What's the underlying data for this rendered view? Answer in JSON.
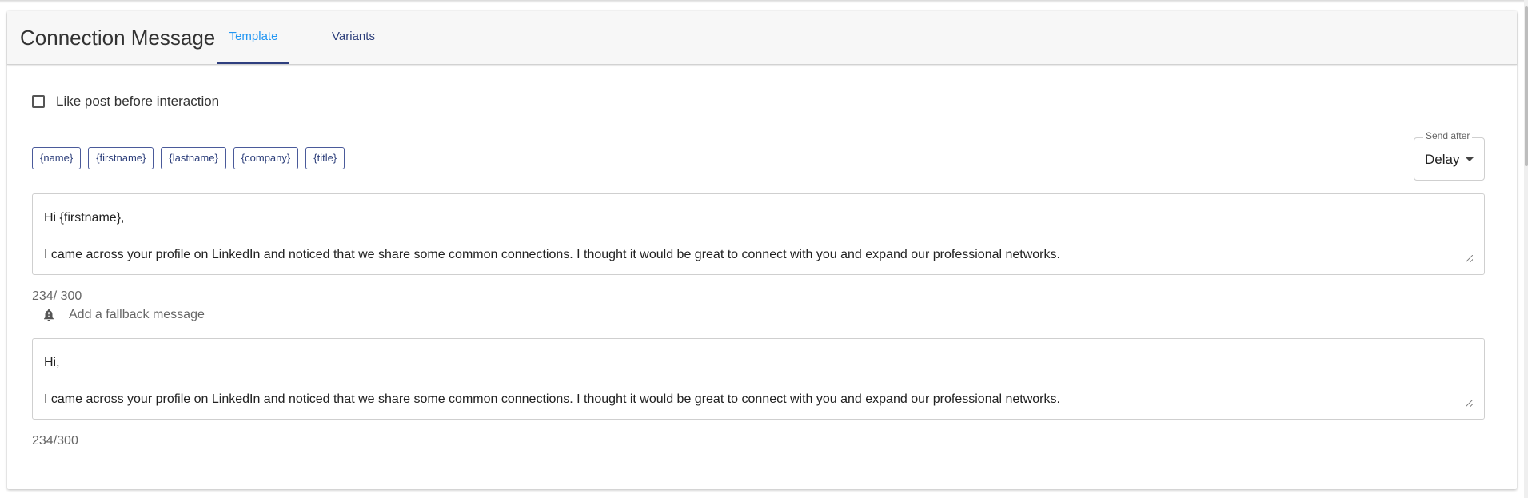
{
  "header": {
    "title": "Connection Message",
    "tabs": [
      {
        "label": "Template",
        "active": true
      },
      {
        "label": "Variants",
        "active": false
      }
    ]
  },
  "options": {
    "like_post_label": "Like post before interaction",
    "like_post_checked": false
  },
  "variables": [
    "{name}",
    "{firstname}",
    "{lastname}",
    "{company}",
    "{title}"
  ],
  "send_after": {
    "label": "Send after",
    "value": "Delay"
  },
  "message": {
    "lines": [
      "Hi {firstname},",
      "I came across your profile on LinkedIn and noticed that we share some common connections. I thought it would be great to connect with you and expand our professional networks."
    ],
    "counter": "234/ 300"
  },
  "fallback": {
    "toggle_label": "Add a fallback message",
    "icon": "bell-alert-icon",
    "lines": [
      "Hi,",
      "I came across your profile on LinkedIn and noticed that we share some common connections. I thought it would be great to connect with you and expand our professional networks."
    ],
    "counter": "234/300"
  },
  "colors": {
    "accent_blue": "#2196f3",
    "navy": "#2c3e7a",
    "header_bg": "#f7f7f7"
  }
}
